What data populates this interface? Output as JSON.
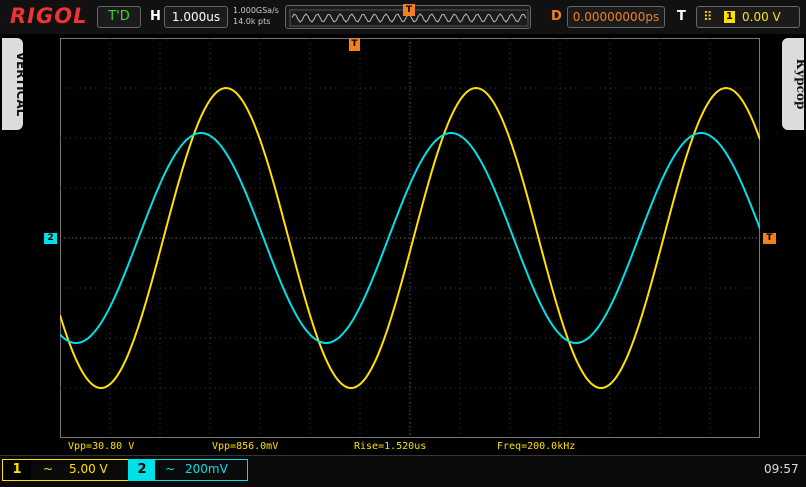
{
  "header": {
    "brand": "RIGOL",
    "run_status": "T'D",
    "timebase_label": "H",
    "timebase_value": "1.000us",
    "sample_rate": "1.000GSa/s",
    "memory_depth": "14.0k pts",
    "delay_label": "D",
    "delay_value": "0.00000000ps",
    "trigger_label": "T",
    "trigger_source": "1",
    "trigger_level": "0.00 V",
    "trigger_marker_top": "T"
  },
  "side": {
    "left_tab": "VERTICAL",
    "right_tab": "Курсор"
  },
  "screen_markers": {
    "ch2_ground": "2",
    "trigger_level": "T"
  },
  "measurements": {
    "vpp1": "Vpp=30.80 V",
    "vpp2": "Vpp=856.0mV",
    "rise": "Rise=1.520us",
    "freq": "Freq=200.0kHz"
  },
  "channels": {
    "ch1": {
      "num": "1",
      "coupling": "~",
      "scale": "5.00 V",
      "color": "#ffe000"
    },
    "ch2": {
      "num": "2",
      "coupling": "~",
      "scale": "200mV",
      "color": "#00e0e8"
    }
  },
  "clock": "09:57",
  "waveforms": {
    "ch1": {
      "color": "#ffe000",
      "frequency_khz": 200.0,
      "vpp_v": 30.8
    },
    "ch2": {
      "color": "#00e0e8",
      "frequency_khz": 200.0,
      "vpp_mv": 856.0
    }
  }
}
